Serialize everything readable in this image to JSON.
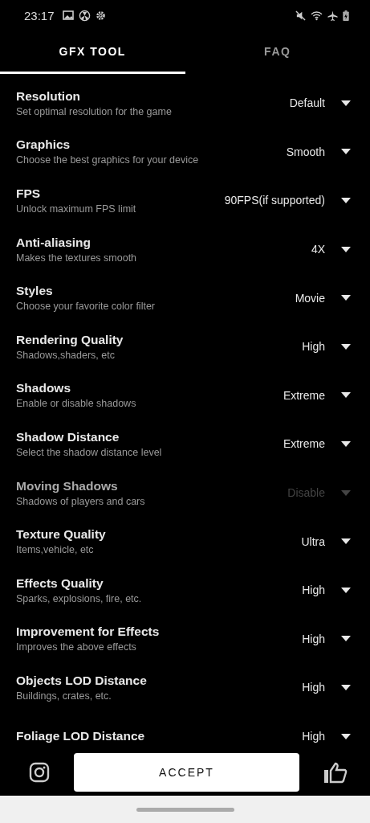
{
  "status_bar": {
    "time": "23:17"
  },
  "tabs": [
    {
      "label": "GFX TOOL",
      "selected": true
    },
    {
      "label": "FAQ",
      "selected": false
    }
  ],
  "settings": [
    {
      "title": "Resolution",
      "subtitle": "Set optimal resolution for the game",
      "value": "Default",
      "disabled": false
    },
    {
      "title": "Graphics",
      "subtitle": "Choose the best graphics for your device",
      "value": "Smooth",
      "disabled": false
    },
    {
      "title": "FPS",
      "subtitle": "Unlock maximum FPS limit",
      "value": "90FPS(if supported)",
      "disabled": false
    },
    {
      "title": "Anti-aliasing",
      "subtitle": "Makes the textures smooth",
      "value": "4X",
      "disabled": false
    },
    {
      "title": "Styles",
      "subtitle": "Choose your favorite color filter",
      "value": "Movie",
      "disabled": false
    },
    {
      "title": "Rendering Quality",
      "subtitle": "Shadows,shaders, etc",
      "value": "High",
      "disabled": false
    },
    {
      "title": "Shadows",
      "subtitle": "Enable or disable shadows",
      "value": "Extreme",
      "disabled": false
    },
    {
      "title": "Shadow Distance",
      "subtitle": "Select the shadow distance level",
      "value": "Extreme",
      "disabled": false
    },
    {
      "title": "Moving Shadows",
      "subtitle": "Shadows of players and cars",
      "value": "Disable",
      "disabled": true
    },
    {
      "title": "Texture Quality",
      "subtitle": "Items,vehicle, etc",
      "value": "Ultra",
      "disabled": false
    },
    {
      "title": "Effects Quality",
      "subtitle": "Sparks, explosions, fire, etc.",
      "value": "High",
      "disabled": false
    },
    {
      "title": "Improvement for Effects",
      "subtitle": "Improves the above effects",
      "value": "High",
      "disabled": false
    },
    {
      "title": "Objects LOD Distance",
      "subtitle": "Buildings, crates, etc.",
      "value": "High",
      "disabled": false
    },
    {
      "title": "Foliage LOD Distance",
      "value": "High",
      "disabled": false
    }
  ],
  "accept_button": "ACCEPT"
}
